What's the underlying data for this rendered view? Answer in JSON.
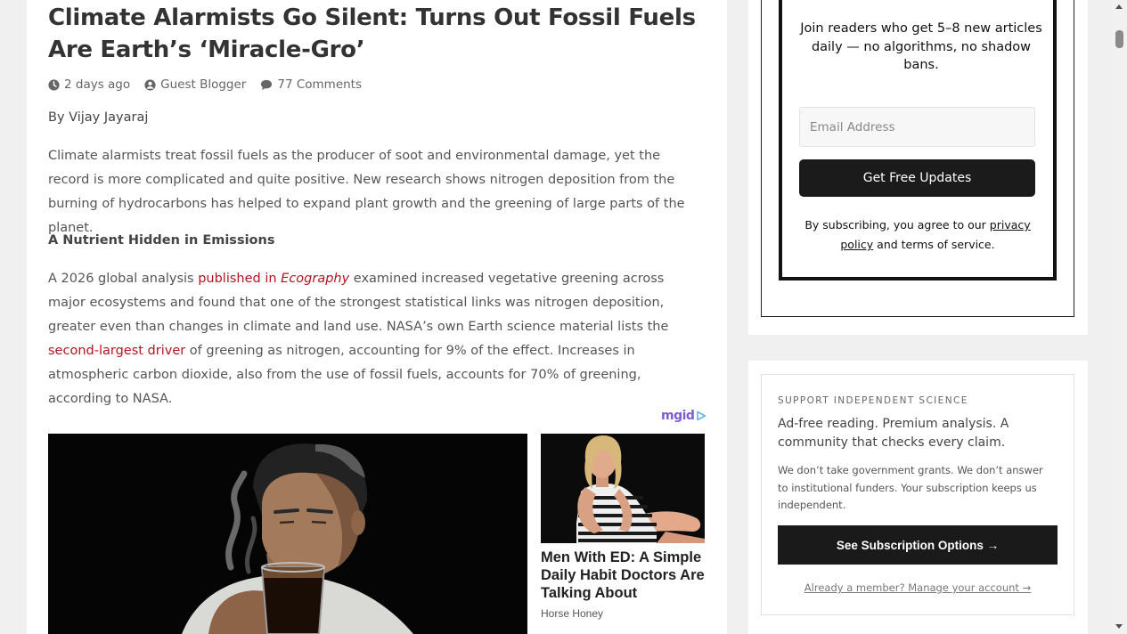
{
  "article": {
    "title": "Climate Alarmists Go Silent: Turns Out Fossil Fuels Are Earth’s ‘Miracle-Gro’",
    "meta": {
      "date": "2 days ago",
      "author": "Guest Blogger",
      "comments": "77 Comments"
    },
    "byline": "By Vijay Jayaraj",
    "para1": "Climate alarmists treat fossil fuels as the producer of soot and environmental damage, yet the record is more complicated and quite positive. New research shows nitrogen deposition from the burning of hydrocarbons has helped to expand plant growth and the greening of large parts of the planet.",
    "subhead": "A Nutrient Hidden in Emissions",
    "para2": {
      "t1": "A 2026 global analysis ",
      "link1a": "published in ",
      "link1b": "Ecography",
      "t2": " examined increased vegetative greening across major ecosystems and found that one of the strongest statistical links was nitrogen deposition, greater even than changes in climate and land use. NASA’s own Earth science material lists the ",
      "link2": "second-largest driver",
      "t3": " of greening as nitrogen, accounting for 9% of the effect. Increases in atmospheric carbon dioxide, also from the use of fossil fuels, accounts for 70% of greening, according to NASA."
    }
  },
  "ads": {
    "brand": "mgid",
    "side_title": "Men With ED: A Simple Daily Habit Doctors Are Talking About",
    "side_source": "Horse Honey"
  },
  "sidebar": {
    "newsletter": {
      "join_text": "Join readers who get 5–8 new articles daily — no algorithms, no shadow bans.",
      "email_placeholder": "Email Address",
      "button": "Get Free Updates",
      "terms_pre": "By subscribing, you agree to our ",
      "terms_link": "privacy policy",
      "terms_post": " and terms of service."
    },
    "support": {
      "kicker": "SUPPORT INDEPENDENT SCIENCE",
      "headline": "Ad-free reading. Premium analysis. A community that checks every claim.",
      "body": "We don’t take government grants. We don’t answer to institutional funders. Your subscription keeps us independent.",
      "button": "See Subscription Options →",
      "manage": "Already a member? Manage your account →"
    }
  },
  "colors": {
    "link": "#b3141e",
    "button": "#1b1b1b",
    "mgid": "#7d5bd0"
  }
}
